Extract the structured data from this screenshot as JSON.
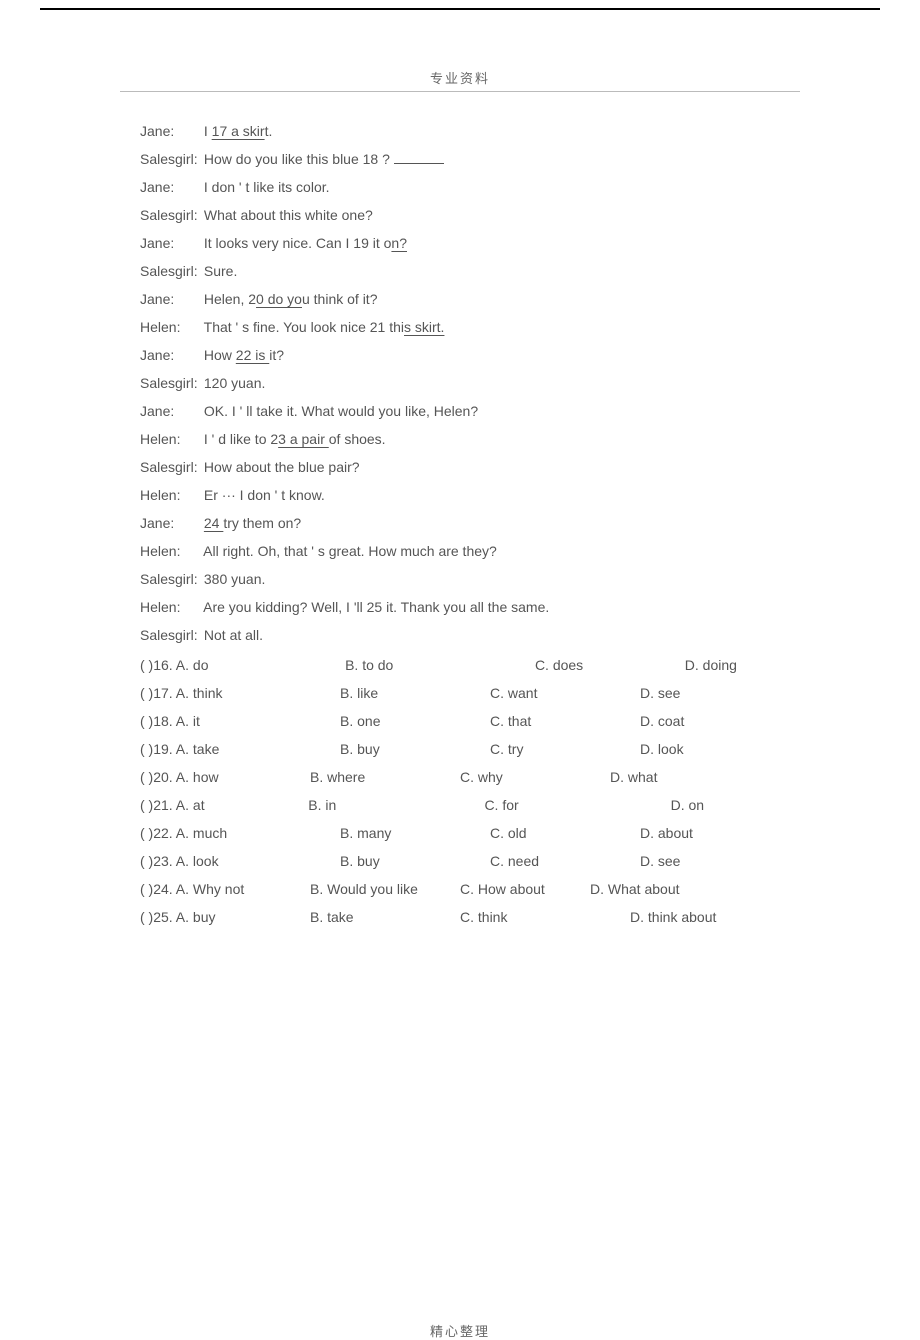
{
  "header": "专业资料",
  "footer": "精心整理",
  "dialogue": [
    {
      "speaker": "Jane:",
      "pre": "I ",
      "u": "  17  a skir",
      "post": "t."
    },
    {
      "speaker": "Salesgirl:",
      "pre": "How do you like this blue      18   ?       ",
      "u": "",
      "post": "",
      "trail_blank": true
    },
    {
      "speaker": "Jane:",
      "pre": "I don ' t like its color.",
      "u": "",
      "post": ""
    },
    {
      "speaker": "Salesgirl:",
      "pre": "What about this white one?",
      "u": "",
      "post": ""
    },
    {
      "speaker": "Jane:",
      "pre": "It looks very nice. Can I        19  it o",
      "u": "n?       ",
      "post": ""
    },
    {
      "speaker": "Salesgirl:",
      "pre": "Sure.",
      "u": "",
      "post": ""
    },
    {
      "speaker": "Jane:",
      "pre": "Helen,  2",
      "u": "0   do yo",
      "post": "u think of it?"
    },
    {
      "speaker": "Helen:",
      "pre": "That         ' s fine. You look nice 21  thi",
      "u": "s  skirt.    ",
      "post": ""
    },
    {
      "speaker": "Jane:",
      "pre": "How ",
      "u": "  22    is ",
      "post": "it?"
    },
    {
      "speaker": "Salesgirl:",
      "pre": "120  yuan.",
      "u": "",
      "post": ""
    },
    {
      "speaker": "Jane:",
      "pre": "OK. I  ' ll take it. What would you like, Helen?",
      "u": "",
      "post": ""
    },
    {
      "speaker": "Helen:",
      "pre": "I ' d like to        2",
      "u": "3 a pair ",
      "post": "of shoes."
    },
    {
      "speaker": "Salesgirl:",
      "pre": "How about the blue pair?",
      "u": "",
      "post": ""
    },
    {
      "speaker": "Helen:",
      "pre": "Er     ···  I don     ' t know.",
      "u": "",
      "post": ""
    },
    {
      "speaker": "Jane:",
      "pre": "",
      "u": "   24    ",
      "post": "try them on?"
    },
    {
      "speaker": "Helen:",
      "pre": "All right. Oh, that          ' s great. How much are they?",
      "u": "",
      "post": ""
    },
    {
      "speaker": "Salesgirl:",
      "pre": "380        yuan.",
      "u": "",
      "post": ""
    },
    {
      "speaker": "Helen:",
      "pre": "Are you kidding? Well, I                'll  25  ",
      "u": "       ",
      "post": "it. Thank you all the same."
    },
    {
      "speaker": "Salesgirl:",
      "pre": "Not at all.",
      "u": "",
      "post": ""
    }
  ],
  "questions": [
    {
      "n": "16",
      "a": "A. do",
      "b": "B. to do",
      "c": "C. does",
      "d": "D. doing",
      "off_a": 80,
      "off_c": 80,
      "off_d": 40
    },
    {
      "n": "17",
      "a": "A. think",
      "b": "B. like",
      "c": "C. want",
      "d": "D. see",
      "off_a": 0,
      "off_c": 0,
      "off_d": 0
    },
    {
      "n": "18",
      "a": "A. it",
      "b": "B. one",
      "c": "C. that",
      "d": "D. coat",
      "off_a": 0,
      "off_c": 0,
      "off_d": 0
    },
    {
      "n": "19",
      "a": "A. take",
      "b": "B. buy",
      "c": "C. try",
      "d": "D. look",
      "off_a": 0,
      "off_c": 0,
      "off_d": 0
    },
    {
      "n": "20",
      "a": "A. how",
      "b": "B. where",
      "c": "C. why",
      "d": "D. what",
      "off_a": -30,
      "off_c": 0,
      "off_d": 0
    },
    {
      "n": "21",
      "a": "A. at",
      "b": "B. in",
      "c": "C. for",
      "d": "D. on",
      "off_a": 0,
      "off_c": 50,
      "off_d": 60
    },
    {
      "n": "22",
      "a": "A. much",
      "b": "B. many",
      "c": "C. old",
      "d": "D. about",
      "off_a": 0,
      "off_c": 0,
      "off_d": 0
    },
    {
      "n": "23",
      "a": "A. look",
      "b": "B. buy",
      "c": "C. need",
      "d": "D. see",
      "off_a": 0,
      "off_c": 0,
      "off_d": 0
    },
    {
      "n": "24",
      "a": "A. Why not",
      "b": "B. Would you like",
      "c": "C. How about",
      "d": "D. What about",
      "off_a": -30,
      "off_c": -40,
      "off_d": 20
    },
    {
      "n": "25",
      "a": "A. buy",
      "b": "B. take",
      "c": "C. think",
      "d": "D. think about",
      "off_a": -30,
      "off_c": 0,
      "off_d": 20
    }
  ]
}
